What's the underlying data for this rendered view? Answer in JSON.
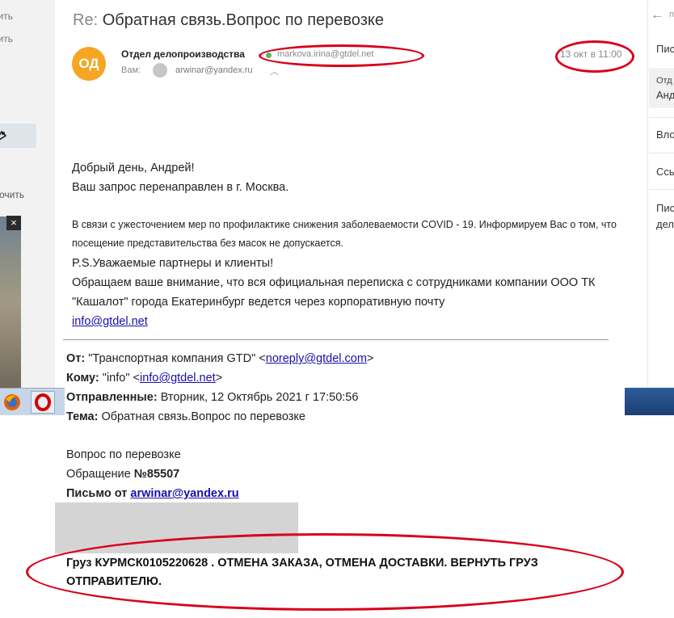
{
  "sidebar": {
    "items": [
      "тить",
      "тить"
    ],
    "bottom_item": "очить",
    "close_glyph": "×"
  },
  "right_panel": {
    "back_glyph": "←",
    "top_clip": "п",
    "labels": [
      "Пис",
      "Отд",
      "Анд",
      "Вло",
      "Ссь",
      "Пис",
      "дел"
    ]
  },
  "email": {
    "subject_prefix": "Re:",
    "subject": "Обратная связь.Вопрос по перевозке",
    "avatar_initials": "ОД",
    "avatar_color": "#f5a623",
    "sender_name": "Отдел делопроизводства",
    "sender_email": "markova.irina@gtdel.net",
    "to_label": "Вам:",
    "to_email": "arwinar@yandex.ru",
    "date": "13 окт в 11:00"
  },
  "body": {
    "greeting": "Добрый день, Андрей!",
    "line2": "Ваш запрос перенаправлен в г. Москва.",
    "covid": "В связи с ужесточением мер по профилактике снижения заболеваемости COVID - 19. Информируем Вас о том, что посещение представительства без масок не допускается.",
    "ps": "P.S.Уважаемые партнеры и клиенты!",
    "notice": "Обращаем ваше внимание, что вся официальная переписка с сотрудниками компании ООО ТК \"Кашалот\" города Екатеринбург ведется через корпоративную почту",
    "notice_link": "info@gtdel.net"
  },
  "quoted": {
    "from_label": "От:",
    "from_name": "\"Транспортная компания GTD\" <",
    "from_email": "noreply@gtdel.com",
    "from_close": ">",
    "to_label": "Кому:",
    "to_name": "\"info\" <",
    "to_email": "info@gtdel.net",
    "to_close": ">",
    "sent_label": "Отправленные:",
    "sent_value": "Вторник, 12 Октябрь 2021 г 17:50:56",
    "subject_label": "Тема:",
    "subject_value": "Обратная связь.Вопрос по перевозке",
    "body_line1": "Вопрос по перевозке",
    "request_label": "Обращение ",
    "request_number": "№85507",
    "letter_from_label": "Письмо от ",
    "letter_from_email": "arwinar@yandex.ru",
    "cargo_text": "Груз КУРМСК0105220628 . ОТМЕНА ЗАКАЗА, ОТМЕНА ДОСТАВКИ. ВЕРНУТЬ ГРУЗ ОТПРАВИТЕЛЮ."
  },
  "colors": {
    "annotation": "#d7001b",
    "link": "#1a0dab",
    "online_dot": "#5cb85c"
  }
}
